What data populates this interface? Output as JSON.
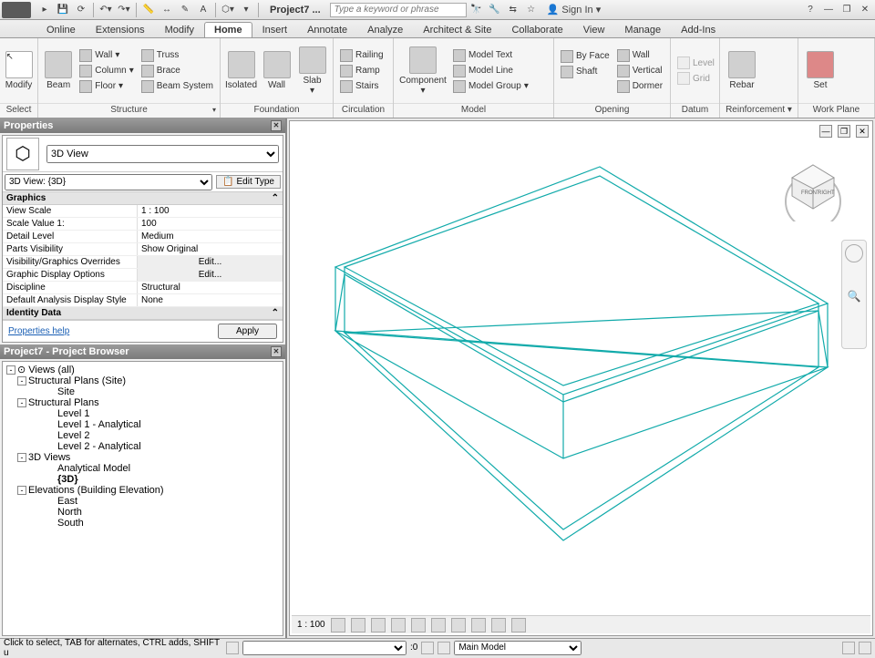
{
  "qat": {
    "title": "Project7 ...",
    "search_placeholder": "Type a keyword or phrase",
    "signin": "Sign In"
  },
  "tabs": [
    "Online",
    "Extensions",
    "Modify",
    "Home",
    "Insert",
    "Annotate",
    "Analyze",
    "Architect & Site",
    "Collaborate",
    "View",
    "Manage",
    "Add-Ins"
  ],
  "active_tab": "Home",
  "ribbon": {
    "select": {
      "title": "Select",
      "modify": "Modify"
    },
    "structure": {
      "title": "Structure",
      "beam": "Beam",
      "wall": "Wall",
      "truss": "Truss",
      "column": "Column",
      "brace": "Brace",
      "floor": "Floor",
      "beam_system": "Beam System"
    },
    "foundation": {
      "title": "Foundation",
      "isolated": "Isolated",
      "wall": "Wall",
      "slab": "Slab"
    },
    "circulation": {
      "title": "Circulation",
      "railing": "Railing",
      "ramp": "Ramp",
      "stairs": "Stairs"
    },
    "model": {
      "title": "Model",
      "component": "Component",
      "model_text": "Model Text",
      "model_line": "Model Line",
      "model_group": "Model Group"
    },
    "opening": {
      "title": "Opening",
      "by_face": "By Face",
      "wall": "Wall",
      "shaft": "Shaft",
      "vertical": "Vertical",
      "dormer": "Dormer"
    },
    "datum": {
      "title": "Datum",
      "level": "Level",
      "grid": "Grid"
    },
    "reinforcement": {
      "title": "Reinforcement",
      "rebar": "Rebar"
    },
    "workplane": {
      "title": "Work Plane",
      "set": "Set"
    }
  },
  "properties": {
    "title": "Properties",
    "type": "3D View",
    "selector": "3D View: {3D}",
    "edit_type": "Edit Type",
    "sections": {
      "graphics": "Graphics",
      "identity": "Identity Data"
    },
    "rows": {
      "view_scale": {
        "label": "View Scale",
        "val": "1 : 100"
      },
      "scale_value": {
        "label": "Scale Value    1:",
        "val": "100"
      },
      "detail_level": {
        "label": "Detail Level",
        "val": "Medium"
      },
      "parts_vis": {
        "label": "Parts Visibility",
        "val": "Show Original"
      },
      "vg_overrides": {
        "label": "Visibility/Graphics Overrides",
        "val": "Edit..."
      },
      "gdo": {
        "label": "Graphic Display Options",
        "val": "Edit..."
      },
      "discipline": {
        "label": "Discipline",
        "val": "Structural"
      },
      "dads": {
        "label": "Default Analysis Display Style",
        "val": "None"
      }
    },
    "help": "Properties help",
    "apply": "Apply"
  },
  "browser": {
    "title": "Project7 - Project Browser",
    "root": "Views (all)",
    "nodes": {
      "sp_site": "Structural Plans (Site)",
      "site": "Site",
      "sp": "Structural Plans",
      "l1": "Level 1",
      "l1a": "Level 1 - Analytical",
      "l2": "Level 2",
      "l2a": "Level 2 - Analytical",
      "views3d": "3D Views",
      "am": "Analytical Model",
      "current": "{3D}",
      "elev": "Elevations (Building Elevation)",
      "east": "East",
      "north": "North",
      "south": "South"
    }
  },
  "viewbar": {
    "scale": "1 : 100",
    "zero": ":0"
  },
  "status": {
    "msg": "Click to select, TAB for alternates, CTRL adds, SHIFT u",
    "workset": "Main Model"
  }
}
